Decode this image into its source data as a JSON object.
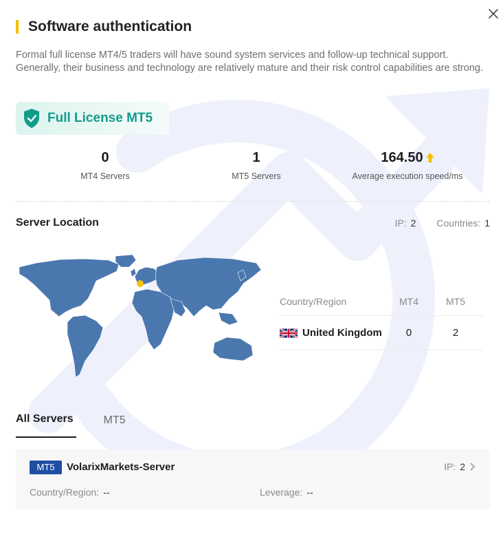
{
  "modal": {
    "title": "Software authentication",
    "description": "Formal full license MT4/5 traders will have sound system services and follow-up technical support. Generally, their business and technology are relatively mature and their risk control capabilities are strong.",
    "close_icon": "close-icon"
  },
  "license": {
    "label": "Full License MT5",
    "icon": "shield-check-icon",
    "color": "#139b8a"
  },
  "stats": [
    {
      "value": "0",
      "label": "MT4 Servers"
    },
    {
      "value": "1",
      "label": "MT5 Servers"
    },
    {
      "value": "164.50",
      "label": "Average execution speed/ms",
      "indicator": "up-arrow-icon",
      "indicator_color": "#f5c000"
    }
  ],
  "server_location": {
    "title": "Server Location",
    "ip_label": "IP:",
    "ip_value": "2",
    "countries_label": "Countries:",
    "countries_value": "1",
    "map_color": "#4a78ae",
    "marker_color": "#f5c000"
  },
  "region_table": {
    "headers": [
      "Country/Region",
      "MT4",
      "MT5"
    ],
    "rows": [
      {
        "flag": "uk-flag-icon",
        "country": "United Kingdom",
        "mt4": "0",
        "mt5": "2"
      }
    ]
  },
  "tabs": [
    {
      "label": "All Servers",
      "active": true
    },
    {
      "label": "MT5",
      "active": false
    }
  ],
  "servers": [
    {
      "type": "MT5",
      "name": "VolarixMarkets-Server",
      "ip_label": "IP:",
      "ip_value": "2",
      "country_label": "Country/Region:",
      "country_value": "--",
      "leverage_label": "Leverage:",
      "leverage_value": "--"
    }
  ],
  "colors": {
    "accent_yellow": "#f5c000",
    "brand_teal": "#139b8a",
    "tag_blue": "#1f4ea3"
  }
}
